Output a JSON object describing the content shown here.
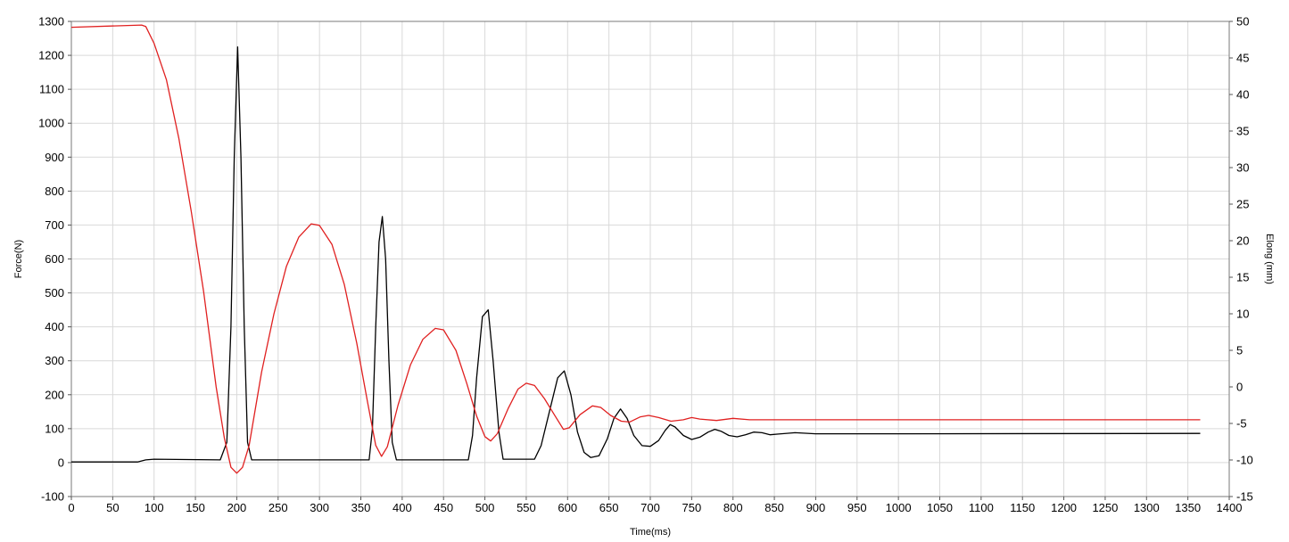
{
  "chart_data": {
    "type": "line",
    "title": "",
    "xlabel": "Time(ms)",
    "ylabel_left": "Force(N)",
    "ylabel_right": "Elong (mm)",
    "xlim": [
      0,
      1400
    ],
    "ylim_left": [
      -100,
      1300
    ],
    "ylim_right": [
      -15,
      50
    ],
    "x_ticks": [
      0,
      50,
      100,
      150,
      200,
      250,
      300,
      350,
      400,
      450,
      500,
      550,
      600,
      650,
      700,
      750,
      800,
      850,
      900,
      950,
      1000,
      1050,
      1100,
      1150,
      1200,
      1250,
      1300,
      1350,
      1400
    ],
    "y_ticks_left": [
      -100,
      0,
      100,
      200,
      300,
      400,
      500,
      600,
      700,
      800,
      900,
      1000,
      1100,
      1200,
      1300
    ],
    "y_ticks_right": [
      -15,
      -10,
      -5,
      0,
      5,
      10,
      15,
      20,
      25,
      30,
      35,
      40,
      45,
      50
    ],
    "grid": true,
    "legend": "none",
    "series": [
      {
        "axis": "left",
        "color": "#000000",
        "values": [
          [
            0,
            2
          ],
          [
            80,
            2
          ],
          [
            90,
            8
          ],
          [
            100,
            10
          ],
          [
            180,
            8
          ],
          [
            188,
            60
          ],
          [
            193,
            400
          ],
          [
            197,
            900
          ],
          [
            201,
            1225
          ],
          [
            205,
            900
          ],
          [
            209,
            400
          ],
          [
            213,
            60
          ],
          [
            218,
            8
          ],
          [
            360,
            8
          ],
          [
            364,
            100
          ],
          [
            368,
            400
          ],
          [
            372,
            650
          ],
          [
            376,
            725
          ],
          [
            380,
            600
          ],
          [
            384,
            300
          ],
          [
            388,
            60
          ],
          [
            393,
            8
          ],
          [
            480,
            8
          ],
          [
            485,
            80
          ],
          [
            490,
            250
          ],
          [
            497,
            430
          ],
          [
            504,
            450
          ],
          [
            510,
            300
          ],
          [
            517,
            90
          ],
          [
            522,
            10
          ],
          [
            560,
            10
          ],
          [
            568,
            50
          ],
          [
            578,
            150
          ],
          [
            588,
            250
          ],
          [
            596,
            270
          ],
          [
            604,
            200
          ],
          [
            612,
            90
          ],
          [
            620,
            30
          ],
          [
            628,
            15
          ],
          [
            638,
            20
          ],
          [
            648,
            70
          ],
          [
            656,
            130
          ],
          [
            664,
            158
          ],
          [
            672,
            130
          ],
          [
            680,
            80
          ],
          [
            690,
            50
          ],
          [
            700,
            48
          ],
          [
            710,
            65
          ],
          [
            718,
            95
          ],
          [
            724,
            112
          ],
          [
            730,
            105
          ],
          [
            740,
            80
          ],
          [
            750,
            68
          ],
          [
            760,
            75
          ],
          [
            770,
            90
          ],
          [
            778,
            98
          ],
          [
            786,
            92
          ],
          [
            795,
            80
          ],
          [
            805,
            76
          ],
          [
            815,
            82
          ],
          [
            825,
            90
          ],
          [
            835,
            88
          ],
          [
            845,
            82
          ],
          [
            855,
            84
          ],
          [
            875,
            88
          ],
          [
            900,
            85
          ],
          [
            1000,
            85
          ],
          [
            1365,
            86
          ]
        ]
      },
      {
        "axis": "right",
        "color": "#e02020",
        "values": [
          [
            0,
            49.2
          ],
          [
            85,
            49.5
          ],
          [
            90,
            49.3
          ],
          [
            100,
            47
          ],
          [
            115,
            42
          ],
          [
            130,
            34
          ],
          [
            145,
            24
          ],
          [
            160,
            13
          ],
          [
            175,
            0
          ],
          [
            185,
            -7
          ],
          [
            193,
            -11
          ],
          [
            200,
            -11.8
          ],
          [
            207,
            -11
          ],
          [
            215,
            -8
          ],
          [
            230,
            2
          ],
          [
            245,
            10
          ],
          [
            260,
            16.5
          ],
          [
            275,
            20.5
          ],
          [
            290,
            22.3
          ],
          [
            300,
            22.1
          ],
          [
            315,
            19.5
          ],
          [
            330,
            14
          ],
          [
            345,
            6
          ],
          [
            358,
            -2
          ],
          [
            368,
            -8
          ],
          [
            375,
            -9.5
          ],
          [
            382,
            -8.2
          ],
          [
            395,
            -2.5
          ],
          [
            410,
            3
          ],
          [
            425,
            6.5
          ],
          [
            440,
            8
          ],
          [
            450,
            7.8
          ],
          [
            465,
            5
          ],
          [
            478,
            0.5
          ],
          [
            490,
            -4
          ],
          [
            500,
            -6.8
          ],
          [
            507,
            -7.4
          ],
          [
            515,
            -6.4
          ],
          [
            528,
            -3
          ],
          [
            540,
            -0.3
          ],
          [
            550,
            0.5
          ],
          [
            560,
            0.2
          ],
          [
            572,
            -1.6
          ],
          [
            585,
            -4
          ],
          [
            595,
            -5.8
          ],
          [
            602,
            -5.6
          ],
          [
            615,
            -3.8
          ],
          [
            630,
            -2.6
          ],
          [
            640,
            -2.8
          ],
          [
            652,
            -3.9
          ],
          [
            665,
            -4.7
          ],
          [
            675,
            -4.8
          ],
          [
            688,
            -4.1
          ],
          [
            698,
            -3.9
          ],
          [
            710,
            -4.2
          ],
          [
            725,
            -4.7
          ],
          [
            740,
            -4.5
          ],
          [
            750,
            -4.2
          ],
          [
            760,
            -4.4
          ],
          [
            780,
            -4.6
          ],
          [
            800,
            -4.3
          ],
          [
            820,
            -4.5
          ],
          [
            1000,
            -4.5
          ],
          [
            1365,
            -4.5
          ]
        ]
      }
    ]
  }
}
